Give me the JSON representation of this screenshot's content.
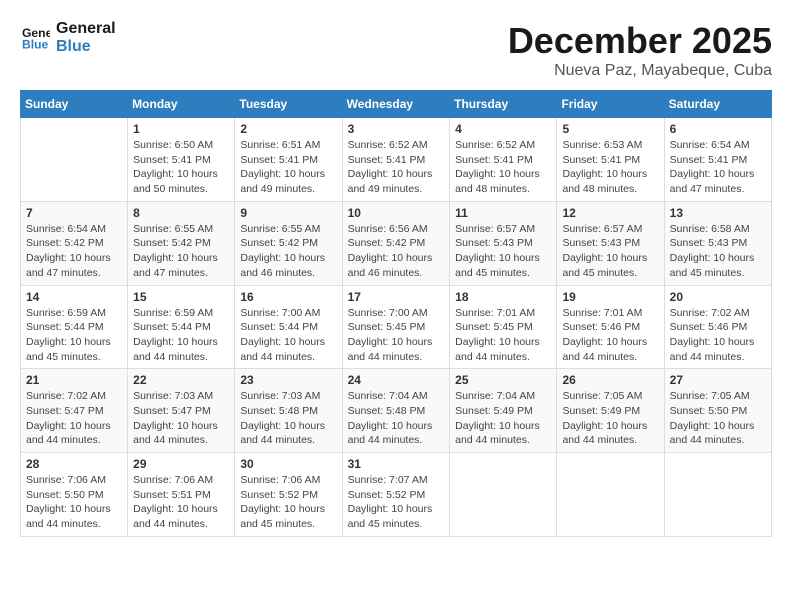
{
  "header": {
    "logo_line1": "General",
    "logo_line2": "Blue",
    "month": "December 2025",
    "location": "Nueva Paz, Mayabeque, Cuba"
  },
  "weekdays": [
    "Sunday",
    "Monday",
    "Tuesday",
    "Wednesday",
    "Thursday",
    "Friday",
    "Saturday"
  ],
  "weeks": [
    [
      {
        "day": "",
        "info": ""
      },
      {
        "day": "1",
        "info": "Sunrise: 6:50 AM\nSunset: 5:41 PM\nDaylight: 10 hours\nand 50 minutes."
      },
      {
        "day": "2",
        "info": "Sunrise: 6:51 AM\nSunset: 5:41 PM\nDaylight: 10 hours\nand 49 minutes."
      },
      {
        "day": "3",
        "info": "Sunrise: 6:52 AM\nSunset: 5:41 PM\nDaylight: 10 hours\nand 49 minutes."
      },
      {
        "day": "4",
        "info": "Sunrise: 6:52 AM\nSunset: 5:41 PM\nDaylight: 10 hours\nand 48 minutes."
      },
      {
        "day": "5",
        "info": "Sunrise: 6:53 AM\nSunset: 5:41 PM\nDaylight: 10 hours\nand 48 minutes."
      },
      {
        "day": "6",
        "info": "Sunrise: 6:54 AM\nSunset: 5:41 PM\nDaylight: 10 hours\nand 47 minutes."
      }
    ],
    [
      {
        "day": "7",
        "info": "Sunrise: 6:54 AM\nSunset: 5:42 PM\nDaylight: 10 hours\nand 47 minutes."
      },
      {
        "day": "8",
        "info": "Sunrise: 6:55 AM\nSunset: 5:42 PM\nDaylight: 10 hours\nand 47 minutes."
      },
      {
        "day": "9",
        "info": "Sunrise: 6:55 AM\nSunset: 5:42 PM\nDaylight: 10 hours\nand 46 minutes."
      },
      {
        "day": "10",
        "info": "Sunrise: 6:56 AM\nSunset: 5:42 PM\nDaylight: 10 hours\nand 46 minutes."
      },
      {
        "day": "11",
        "info": "Sunrise: 6:57 AM\nSunset: 5:43 PM\nDaylight: 10 hours\nand 45 minutes."
      },
      {
        "day": "12",
        "info": "Sunrise: 6:57 AM\nSunset: 5:43 PM\nDaylight: 10 hours\nand 45 minutes."
      },
      {
        "day": "13",
        "info": "Sunrise: 6:58 AM\nSunset: 5:43 PM\nDaylight: 10 hours\nand 45 minutes."
      }
    ],
    [
      {
        "day": "14",
        "info": "Sunrise: 6:59 AM\nSunset: 5:44 PM\nDaylight: 10 hours\nand 45 minutes."
      },
      {
        "day": "15",
        "info": "Sunrise: 6:59 AM\nSunset: 5:44 PM\nDaylight: 10 hours\nand 44 minutes."
      },
      {
        "day": "16",
        "info": "Sunrise: 7:00 AM\nSunset: 5:44 PM\nDaylight: 10 hours\nand 44 minutes."
      },
      {
        "day": "17",
        "info": "Sunrise: 7:00 AM\nSunset: 5:45 PM\nDaylight: 10 hours\nand 44 minutes."
      },
      {
        "day": "18",
        "info": "Sunrise: 7:01 AM\nSunset: 5:45 PM\nDaylight: 10 hours\nand 44 minutes."
      },
      {
        "day": "19",
        "info": "Sunrise: 7:01 AM\nSunset: 5:46 PM\nDaylight: 10 hours\nand 44 minutes."
      },
      {
        "day": "20",
        "info": "Sunrise: 7:02 AM\nSunset: 5:46 PM\nDaylight: 10 hours\nand 44 minutes."
      }
    ],
    [
      {
        "day": "21",
        "info": "Sunrise: 7:02 AM\nSunset: 5:47 PM\nDaylight: 10 hours\nand 44 minutes."
      },
      {
        "day": "22",
        "info": "Sunrise: 7:03 AM\nSunset: 5:47 PM\nDaylight: 10 hours\nand 44 minutes."
      },
      {
        "day": "23",
        "info": "Sunrise: 7:03 AM\nSunset: 5:48 PM\nDaylight: 10 hours\nand 44 minutes."
      },
      {
        "day": "24",
        "info": "Sunrise: 7:04 AM\nSunset: 5:48 PM\nDaylight: 10 hours\nand 44 minutes."
      },
      {
        "day": "25",
        "info": "Sunrise: 7:04 AM\nSunset: 5:49 PM\nDaylight: 10 hours\nand 44 minutes."
      },
      {
        "day": "26",
        "info": "Sunrise: 7:05 AM\nSunset: 5:49 PM\nDaylight: 10 hours\nand 44 minutes."
      },
      {
        "day": "27",
        "info": "Sunrise: 7:05 AM\nSunset: 5:50 PM\nDaylight: 10 hours\nand 44 minutes."
      }
    ],
    [
      {
        "day": "28",
        "info": "Sunrise: 7:06 AM\nSunset: 5:50 PM\nDaylight: 10 hours\nand 44 minutes."
      },
      {
        "day": "29",
        "info": "Sunrise: 7:06 AM\nSunset: 5:51 PM\nDaylight: 10 hours\nand 44 minutes."
      },
      {
        "day": "30",
        "info": "Sunrise: 7:06 AM\nSunset: 5:52 PM\nDaylight: 10 hours\nand 45 minutes."
      },
      {
        "day": "31",
        "info": "Sunrise: 7:07 AM\nSunset: 5:52 PM\nDaylight: 10 hours\nand 45 minutes."
      },
      {
        "day": "",
        "info": ""
      },
      {
        "day": "",
        "info": ""
      },
      {
        "day": "",
        "info": ""
      }
    ]
  ]
}
